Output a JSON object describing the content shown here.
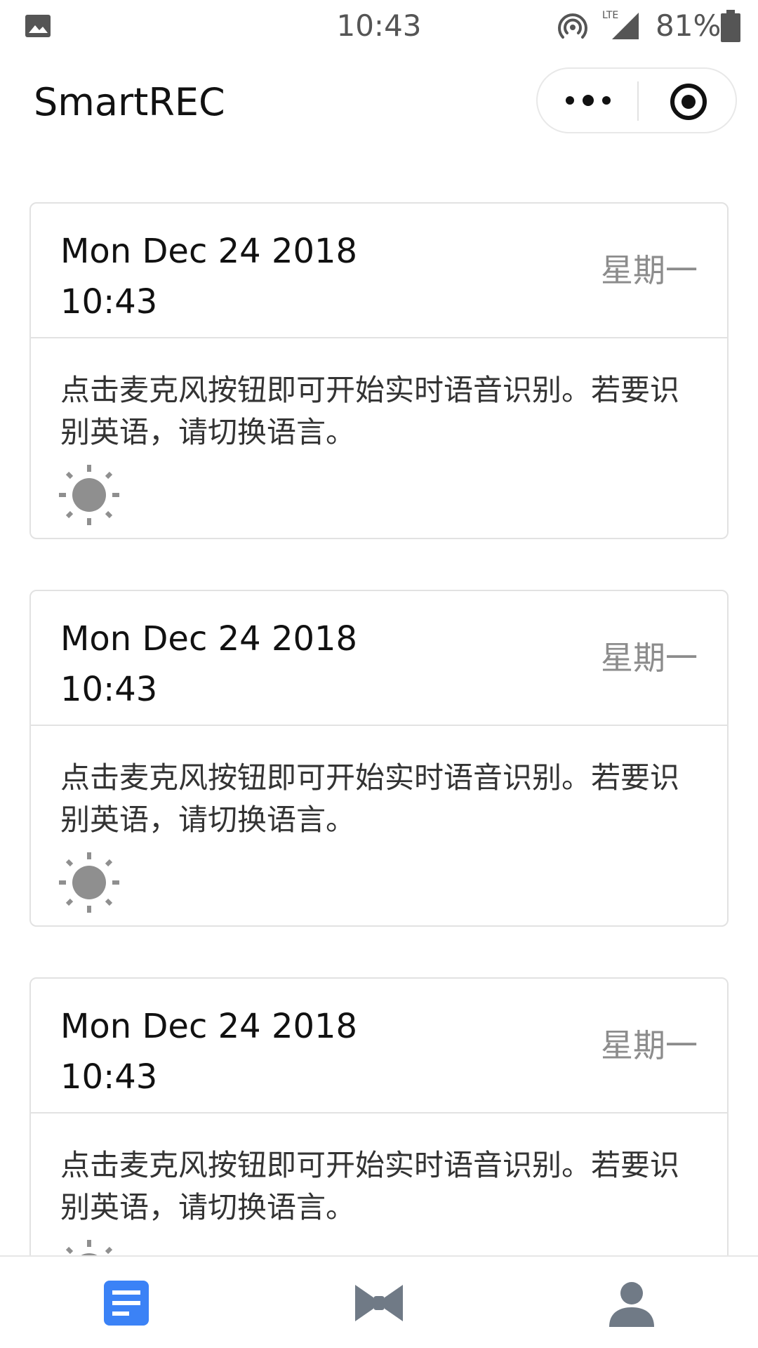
{
  "status_bar": {
    "time": "10:43",
    "network": "LTE",
    "battery": "81%",
    "icons": [
      "gallery-icon",
      "hotspot-icon",
      "signal-icon",
      "battery-icon"
    ]
  },
  "nav": {
    "title": "SmartREC",
    "capsule_icons": [
      "more-icon",
      "close-target-icon"
    ]
  },
  "cards": [
    {
      "date": "Mon Dec 24 2018",
      "time": "10:43",
      "weekday": "星期一",
      "body": "点击麦克风按钮即可开始实时语音识别。若要识别英语，请切换语言。",
      "icon": "sun-icon"
    },
    {
      "date": "Mon Dec 24 2018",
      "time": "10:43",
      "weekday": "星期一",
      "body": "点击麦克风按钮即可开始实时语音识别。若要识别英语，请切换语言。",
      "icon": "sun-icon"
    },
    {
      "date": "Mon Dec 24 2018",
      "time": "10:43",
      "weekday": "星期一",
      "body": "点击麦克风按钮即可开始实时语音识别。若要识别英语，请切换语言。",
      "icon": "sun-icon"
    }
  ],
  "tabbar": {
    "tabs": [
      {
        "icon": "document-icon",
        "active": true
      },
      {
        "icon": "bowtie-icon",
        "active": false
      },
      {
        "icon": "user-icon",
        "active": false
      }
    ],
    "active_color": "#3b82f6",
    "inactive_color": "#707a86"
  }
}
